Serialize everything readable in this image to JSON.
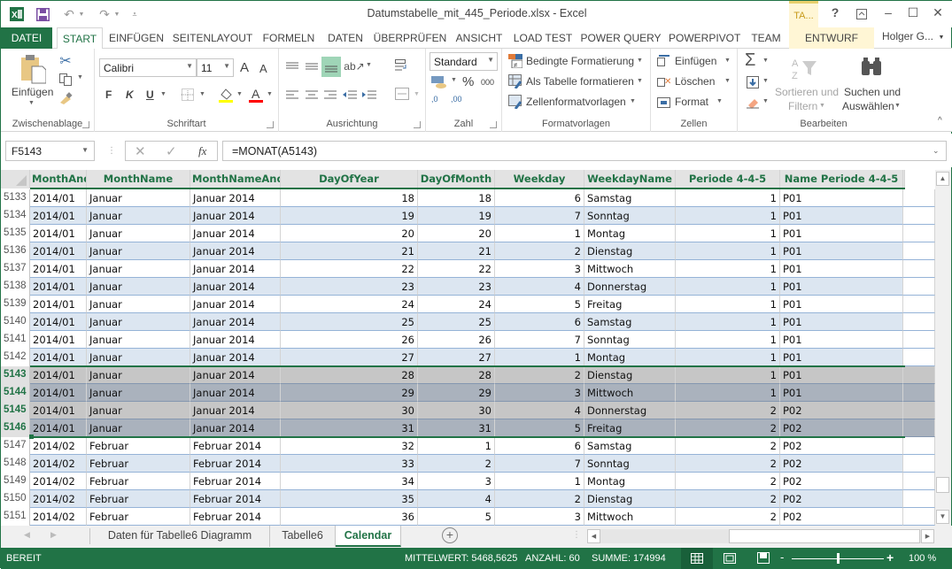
{
  "window": {
    "title": "Datumstabelle_mit_445_Periode.xlsx - Excel",
    "contextual_tab_group": "TA...",
    "help": "?",
    "user": "Holger G...",
    "qat": {
      "app_icon": "excel-icon",
      "save": "save-icon",
      "undo": "undo-icon",
      "redo": "redo-icon",
      "customize": "customize-qat-icon"
    }
  },
  "tabs": [
    {
      "label": "DATEI"
    },
    {
      "label": "START"
    },
    {
      "label": "EINFÜGEN"
    },
    {
      "label": "SEITENLAYOUT"
    },
    {
      "label": "FORMELN"
    },
    {
      "label": "DATEN"
    },
    {
      "label": "ÜBERPRÜFEN"
    },
    {
      "label": "ANSICHT"
    },
    {
      "label": "LOAD TEST"
    },
    {
      "label": "POWER QUERY"
    },
    {
      "label": "POWERPIVOT"
    },
    {
      "label": "TEAM"
    },
    {
      "label": "ENTWURF"
    }
  ],
  "ribbon": {
    "clipboard": {
      "label": "Zwischenablage",
      "paste": "Einfügen"
    },
    "font": {
      "label": "Schriftart",
      "font_name": "Calibri",
      "font_size": "11",
      "bold": "F",
      "italic": "K",
      "underline": "U",
      "grow": "A",
      "shrink": "A",
      "fill_color": "#ffff00",
      "font_color": "#ff0000"
    },
    "alignment": {
      "label": "Ausrichtung"
    },
    "number": {
      "label": "Zahl",
      "format": "Standard",
      "percent": "%",
      "thousands": "000",
      "inc_decimal": ",0",
      "dec_decimal": ",00"
    },
    "styles": {
      "label": "Formatvorlagen",
      "conditional": "Bedingte Formatierung",
      "as_table": "Als Tabelle formatieren",
      "cell_styles": "Zellenformatvorlagen"
    },
    "cells": {
      "label": "Zellen",
      "insert": "Einfügen",
      "delete": "Löschen",
      "format": "Format"
    },
    "editing": {
      "label": "Bearbeiten",
      "sum": "Σ",
      "sort_1": "Sortieren und",
      "sort_2": "Filtern",
      "find_1": "Suchen und",
      "find_2": "Auswählen"
    }
  },
  "formula_bar": {
    "name_box": "F5143",
    "fx": "fx",
    "formula": "=MONAT(A5143)"
  },
  "grid": {
    "columns": [
      "MonthAnd",
      "MonthName",
      "MonthNameAnd",
      "DayOfYear",
      "DayOfMonth",
      "Weekday",
      "WeekdayName",
      "Periode 4-4-5",
      "Name Periode 4-4-5"
    ],
    "rows": [
      {
        "n": "5133",
        "v": [
          "2014/01",
          "Januar",
          "Januar 2014",
          "18",
          "18",
          "6",
          "Samstag",
          "1",
          "P01"
        ],
        "selected": false
      },
      {
        "n": "5134",
        "v": [
          "2014/01",
          "Januar",
          "Januar 2014",
          "19",
          "19",
          "7",
          "Sonntag",
          "1",
          "P01"
        ],
        "selected": false
      },
      {
        "n": "5135",
        "v": [
          "2014/01",
          "Januar",
          "Januar 2014",
          "20",
          "20",
          "1",
          "Montag",
          "1",
          "P01"
        ],
        "selected": false
      },
      {
        "n": "5136",
        "v": [
          "2014/01",
          "Januar",
          "Januar 2014",
          "21",
          "21",
          "2",
          "Dienstag",
          "1",
          "P01"
        ],
        "selected": false
      },
      {
        "n": "5137",
        "v": [
          "2014/01",
          "Januar",
          "Januar 2014",
          "22",
          "22",
          "3",
          "Mittwoch",
          "1",
          "P01"
        ],
        "selected": false
      },
      {
        "n": "5138",
        "v": [
          "2014/01",
          "Januar",
          "Januar 2014",
          "23",
          "23",
          "4",
          "Donnerstag",
          "1",
          "P01"
        ],
        "selected": false
      },
      {
        "n": "5139",
        "v": [
          "2014/01",
          "Januar",
          "Januar 2014",
          "24",
          "24",
          "5",
          "Freitag",
          "1",
          "P01"
        ],
        "selected": false
      },
      {
        "n": "5140",
        "v": [
          "2014/01",
          "Januar",
          "Januar 2014",
          "25",
          "25",
          "6",
          "Samstag",
          "1",
          "P01"
        ],
        "selected": false
      },
      {
        "n": "5141",
        "v": [
          "2014/01",
          "Januar",
          "Januar 2014",
          "26",
          "26",
          "7",
          "Sonntag",
          "1",
          "P01"
        ],
        "selected": false
      },
      {
        "n": "5142",
        "v": [
          "2014/01",
          "Januar",
          "Januar 2014",
          "27",
          "27",
          "1",
          "Montag",
          "1",
          "P01"
        ],
        "selected": false
      },
      {
        "n": "5143",
        "v": [
          "2014/01",
          "Januar",
          "Januar 2014",
          "28",
          "28",
          "2",
          "Dienstag",
          "1",
          "P01"
        ],
        "selected": true
      },
      {
        "n": "5144",
        "v": [
          "2014/01",
          "Januar",
          "Januar 2014",
          "29",
          "29",
          "3",
          "Mittwoch",
          "1",
          "P01"
        ],
        "selected": true
      },
      {
        "n": "5145",
        "v": [
          "2014/01",
          "Januar",
          "Januar 2014",
          "30",
          "30",
          "4",
          "Donnerstag",
          "2",
          "P02"
        ],
        "selected": true
      },
      {
        "n": "5146",
        "v": [
          "2014/01",
          "Januar",
          "Januar 2014",
          "31",
          "31",
          "5",
          "Freitag",
          "2",
          "P02"
        ],
        "selected": true
      },
      {
        "n": "5147",
        "v": [
          "2014/02",
          "Februar",
          "Februar 2014",
          "32",
          "1",
          "6",
          "Samstag",
          "2",
          "P02"
        ],
        "selected": false
      },
      {
        "n": "5148",
        "v": [
          "2014/02",
          "Februar",
          "Februar 2014",
          "33",
          "2",
          "7",
          "Sonntag",
          "2",
          "P02"
        ],
        "selected": false
      },
      {
        "n": "5149",
        "v": [
          "2014/02",
          "Februar",
          "Februar 2014",
          "34",
          "3",
          "1",
          "Montag",
          "2",
          "P02"
        ],
        "selected": false
      },
      {
        "n": "5150",
        "v": [
          "2014/02",
          "Februar",
          "Februar 2014",
          "35",
          "4",
          "2",
          "Dienstag",
          "2",
          "P02"
        ],
        "selected": false
      },
      {
        "n": "5151",
        "v": [
          "2014/02",
          "Februar",
          "Februar 2014",
          "36",
          "5",
          "3",
          "Mittwoch",
          "2",
          "P02"
        ],
        "selected": false
      }
    ]
  },
  "sheets": [
    {
      "label": "Daten für Tabelle6 Diagramm",
      "active": false
    },
    {
      "label": "Tabelle6",
      "active": false
    },
    {
      "label": "Calendar",
      "active": true
    }
  ],
  "status": {
    "ready": "BEREIT",
    "average": "MITTELWERT: 5468,5625",
    "count": "ANZAHL: 60",
    "sum": "SUMME: 174994",
    "zoom": "100 %",
    "zoom_percent": 100
  }
}
